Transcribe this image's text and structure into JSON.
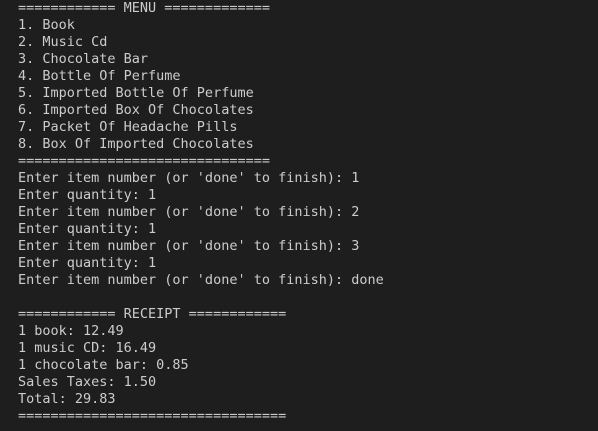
{
  "terminal": {
    "menu_header": "============ MENU =============",
    "menu_items": [
      "1. Book",
      "2. Music Cd",
      "3. Chocolate Bar",
      "4. Bottle Of Perfume",
      "5. Imported Bottle Of Perfume",
      "6. Imported Box Of Chocolates",
      "7. Packet Of Headache Pills",
      "8. Box Of Imported Chocolates"
    ],
    "menu_footer": "===============================",
    "prompts": [
      "Enter item number (or 'done' to finish): 1",
      "Enter quantity: 1",
      "Enter item number (or 'done' to finish): 2",
      "Enter quantity: 1",
      "Enter item number (or 'done' to finish): 3",
      "Enter quantity: 1",
      "Enter item number (or 'done' to finish): done"
    ],
    "receipt_header": "============ RECEIPT ============",
    "receipt_lines": [
      "1 book: 12.49",
      "1 music CD: 16.49",
      "1 chocolate bar: 0.85",
      "Sales Taxes: 1.50",
      "Total: 29.83"
    ],
    "receipt_footer": "================================="
  }
}
